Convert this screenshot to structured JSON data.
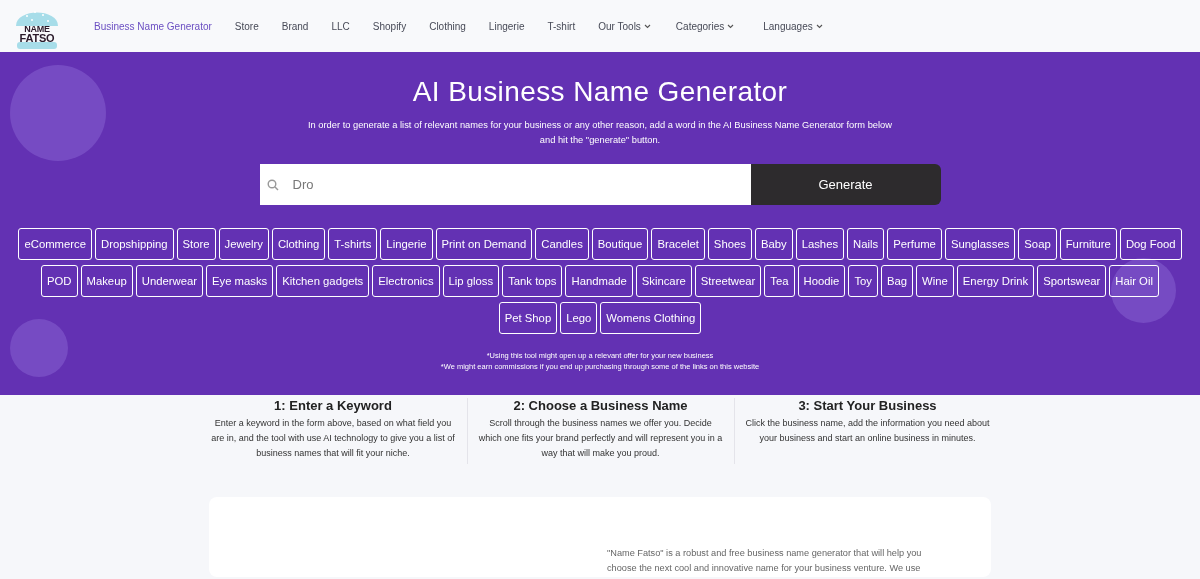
{
  "logo": {
    "line_1": "NAME",
    "line_2": "FATSO"
  },
  "nav": [
    {
      "label": "Business Name Generator",
      "selected": true,
      "dropdown": false
    },
    {
      "label": "Store",
      "selected": false,
      "dropdown": false
    },
    {
      "label": "Brand",
      "selected": false,
      "dropdown": false
    },
    {
      "label": "LLC",
      "selected": false,
      "dropdown": false
    },
    {
      "label": "Shopify",
      "selected": false,
      "dropdown": false
    },
    {
      "label": "Clothing",
      "selected": false,
      "dropdown": false
    },
    {
      "label": "Lingerie",
      "selected": false,
      "dropdown": false
    },
    {
      "label": "T-shirt",
      "selected": false,
      "dropdown": false
    },
    {
      "label": "Our Tools",
      "selected": false,
      "dropdown": true
    },
    {
      "label": "Categories",
      "selected": false,
      "dropdown": true
    },
    {
      "label": "Languages",
      "selected": false,
      "dropdown": true
    }
  ],
  "hero": {
    "title": "AI Business Name Generator",
    "subtitle": "In order to generate a list of relevant names for your business or any other reason, add a word in the AI Business Name Generator form below and hit the \"generate\" button.",
    "search": {
      "value": "Dro",
      "button": "Generate"
    },
    "tag_rows": [
      [
        "eCommerce",
        "Dropshipping",
        "Store",
        "Jewelry",
        "Clothing",
        "T-shirts",
        "Lingerie",
        "Print on Demand",
        "Candles",
        "Boutique",
        "Bracelet",
        "Shoes",
        "Baby",
        "Lashes",
        "Nails",
        "Perfume",
        "Sunglasses",
        "Soap",
        "Furniture",
        "Dog Food"
      ],
      [
        "POD",
        "Makeup",
        "Underwear",
        "Eye masks",
        "Kitchen gadgets",
        "Electronics",
        "Lip gloss",
        "Tank tops",
        "Handmade",
        "Skincare",
        "Streetwear",
        "Tea",
        "Hoodie",
        "Toy",
        "Bag",
        "Wine",
        "Energy Drink",
        "Sportswear",
        "Hair Oil"
      ],
      [
        "Pet Shop",
        "Lego",
        "Womens Clothing"
      ]
    ],
    "notes": [
      "*Using this tool might open up a relevant offer for your new business",
      "*We might earn commissions if you end up purchasing through some of the links on this website"
    ]
  },
  "steps": [
    {
      "title": "1: Enter a Keyword",
      "text": "Enter a keyword in the form above, based on what field you are in, and the tool with use AI technology to give you a list of business names that will fit your niche."
    },
    {
      "title": "2: Choose a Business Name",
      "text": "Scroll through the business names we offer you. Decide which one fits your brand perfectly and will represent you in a way that will make you proud."
    },
    {
      "title": "3: Start Your Business",
      "text": "Click the business name, add the information you need about your business and start an online business in minutes."
    }
  ],
  "about": {
    "text": "\"Name Fatso\" is a robust and free business name generator that will help you choose the next cool and innovative name for your business venture. We use"
  }
}
